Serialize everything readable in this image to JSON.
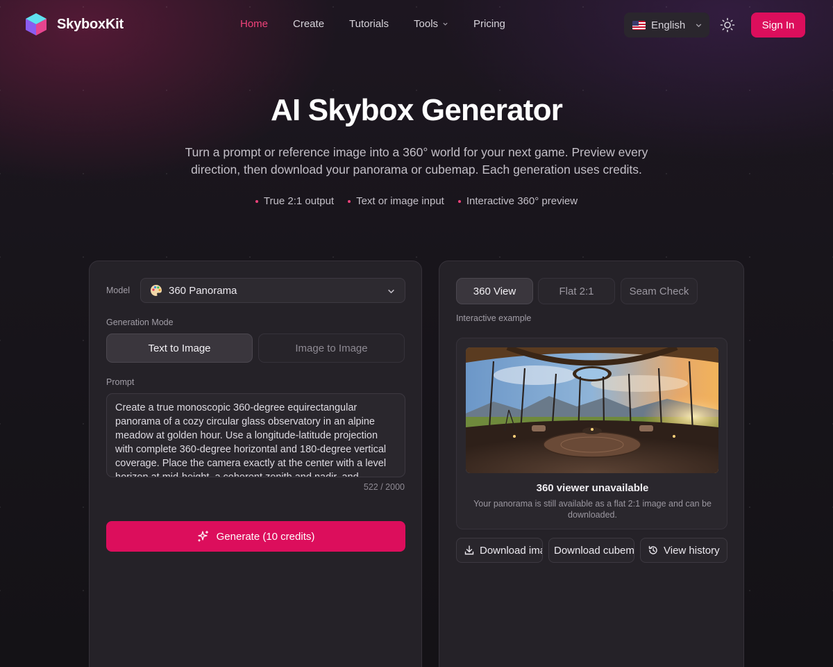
{
  "brand": {
    "name": "SkyboxKit"
  },
  "nav": {
    "links": [
      {
        "label": "Home",
        "active": true
      },
      {
        "label": "Create"
      },
      {
        "label": "Tutorials"
      },
      {
        "label": "Tools",
        "dropdown": true
      },
      {
        "label": "Pricing"
      }
    ],
    "language": "English",
    "sign_in": "Sign In"
  },
  "hero": {
    "title": "AI Skybox Generator",
    "subtitle": "Turn a prompt or reference image into a 360° world for your next game. Preview every direction, then download your panorama or cubemap. Each generation uses credits.",
    "bullets": [
      "True 2:1 output",
      "Text or image input",
      "Interactive 360° preview"
    ]
  },
  "form": {
    "model_label": "Model",
    "model_value": "360 Panorama",
    "mode_label": "Generation Mode",
    "modes": [
      "Text to Image",
      "Image to Image"
    ],
    "prompt_label": "Prompt",
    "prompt_text": "Create a true monoscopic 360-degree equirectangular panorama of a cozy circular glass observatory in an alpine meadow at golden hour. Use a longitude-latitude projection with complete 360-degree horizontal and 180-degree vertical coverage. Place the camera exactly at the center with a level horizon at mid-height, a coherent zenith and nadir, and seamless left and right edges.",
    "counter": "522 / 2000",
    "generate_label": "Generate (10 credits)"
  },
  "preview": {
    "tabs": [
      "360 View",
      "Flat 2:1",
      "Seam Check"
    ],
    "caption": "Interactive example",
    "unavailable_title": "360 viewer unavailable",
    "unavailable_text": "Your panorama is still available as a flat 2:1 image and can be downloaded.",
    "actions": [
      "Download image",
      "Download cubemap",
      "View history"
    ]
  },
  "colors": {
    "accent": "#dc0e5c",
    "active_nav": "#f0427a",
    "panel": "#252228"
  }
}
